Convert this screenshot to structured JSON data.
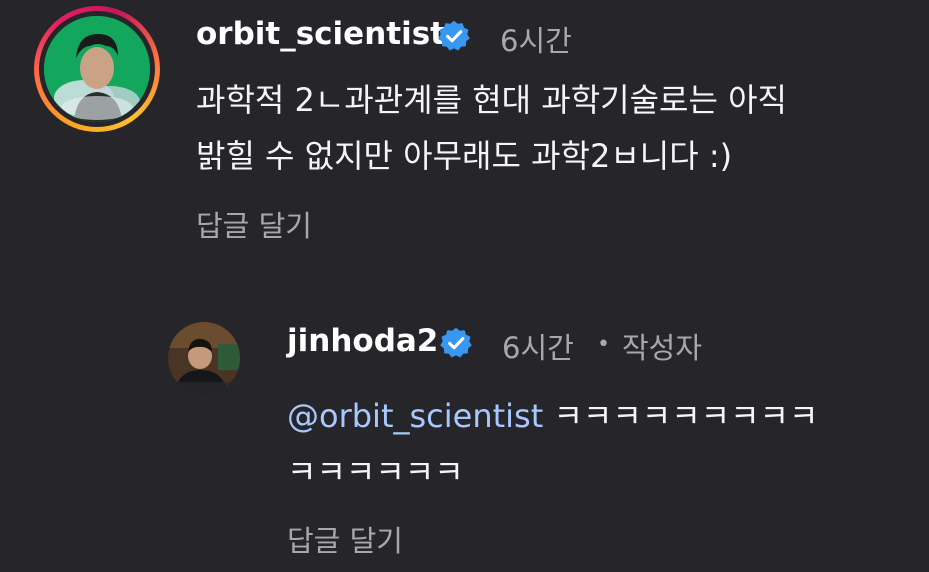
{
  "comment": {
    "username": "orbit_scientist",
    "time": "6시간",
    "text_line1": "과학적 2ㄴ과관계를 현대 과학기술로는 아직",
    "text_line2": "밝힐 수 없지만 아무래도 과학2ㅂ니다 :)",
    "reply_label": "답글 달기",
    "verified_icon": "verified-badge-icon",
    "accent_color": "#3897f0"
  },
  "reply": {
    "username": "jinhoda2",
    "time": "6시간",
    "separator": "•",
    "author_label": "작성자",
    "mention": "@orbit_scientist",
    "text_line1_rest": " ㅋㅋㅋㅋㅋㅋㅋㅋㅋ",
    "text_line2": "ㅋㅋㅋㅋㅋㅋ",
    "reply_label": "답글 달기",
    "verified_icon": "verified-badge-icon"
  }
}
